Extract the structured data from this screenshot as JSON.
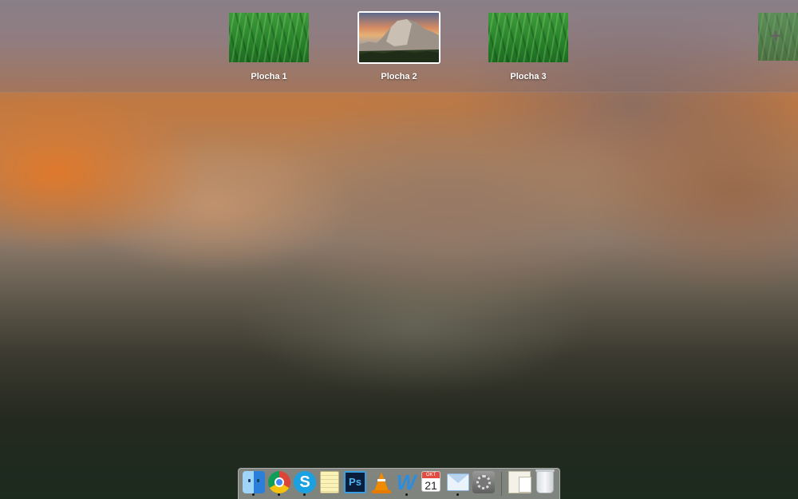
{
  "spaces": {
    "items": [
      {
        "label": "Plocha 1",
        "wallpaper": "grass",
        "active": false
      },
      {
        "label": "Plocha 2",
        "wallpaper": "el-capitan",
        "active": true
      },
      {
        "label": "Plocha 3",
        "wallpaper": "grass",
        "active": false
      }
    ],
    "add_button": {
      "icon": "plus-icon",
      "symbol": "+"
    }
  },
  "dock": {
    "apps": [
      {
        "name": "Finder",
        "icon": "finder-icon",
        "running": true
      },
      {
        "name": "Google Chrome",
        "icon": "chrome-icon",
        "running": true
      },
      {
        "name": "Skype",
        "icon": "skype-icon",
        "running": true,
        "glyph": "S"
      },
      {
        "name": "Notes",
        "icon": "notes-icon",
        "running": false
      },
      {
        "name": "Adobe Photoshop",
        "icon": "photoshop-icon",
        "running": false,
        "glyph": "Ps"
      },
      {
        "name": "VLC",
        "icon": "vlc-icon",
        "running": false
      },
      {
        "name": "Microsoft Word",
        "icon": "word-icon",
        "running": true,
        "glyph": "W"
      },
      {
        "name": "Calendar",
        "icon": "calendar-icon",
        "running": false,
        "month": "OKT",
        "day": "21"
      },
      {
        "name": "Mail",
        "icon": "mail-icon",
        "running": true
      },
      {
        "name": "System Preferences",
        "icon": "system-preferences-icon",
        "running": false
      }
    ],
    "stacks": [
      {
        "name": "Documents",
        "icon": "documents-stack-icon"
      },
      {
        "name": "Trash",
        "icon": "trash-icon"
      }
    ]
  },
  "colors": {
    "accent_orange": "#c07840",
    "active_border": "#ffffff",
    "label_text": "#ffffff"
  }
}
